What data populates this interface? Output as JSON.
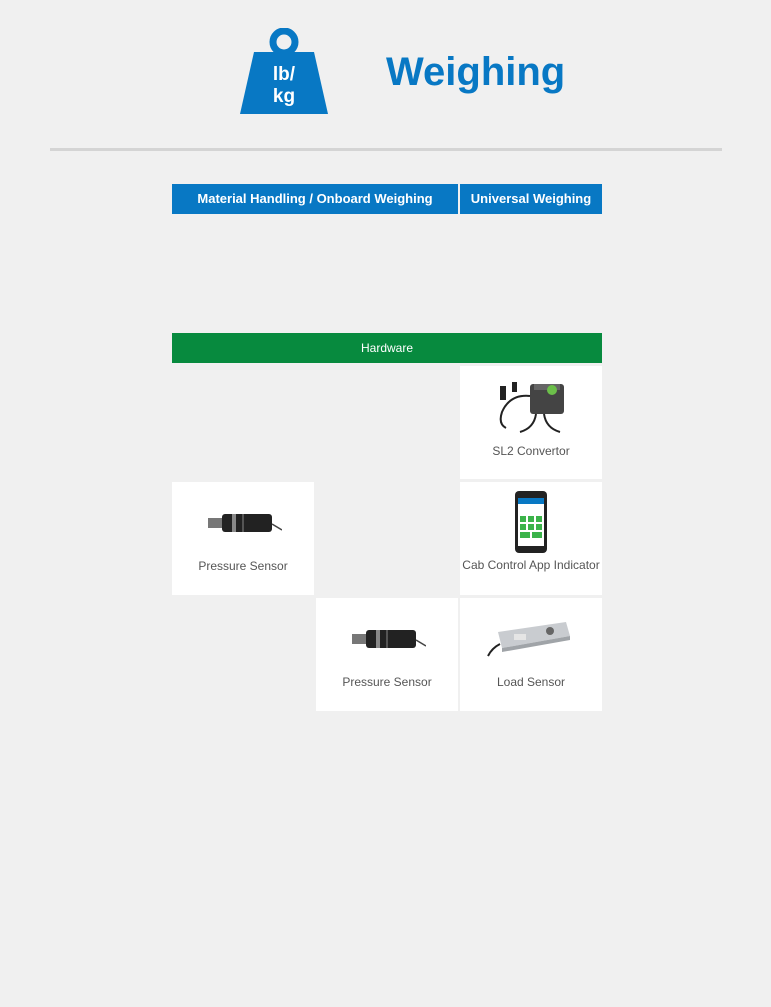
{
  "header": {
    "icon_label_line1": "lb/",
    "icon_label_line2": "kg",
    "title": "Weighing"
  },
  "tabs": [
    {
      "label": "Material Handling / Onboard Weighing"
    },
    {
      "label": "Universal Weighing"
    }
  ],
  "hardware": {
    "title": "Hardware",
    "items": {
      "sl2": "SL2 Convertor",
      "pressure_left": "Pressure Sensor",
      "cab_app": "Cab Control App Indicator",
      "pressure_mid": "Pressure Sensor",
      "load": "Load Sensor"
    }
  },
  "colors": {
    "brand_blue": "#0878c4",
    "hardware_green": "#078a3e",
    "background": "#f0f0f0"
  }
}
